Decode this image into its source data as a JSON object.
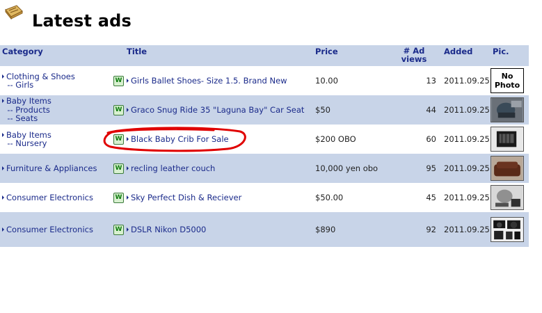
{
  "page": {
    "title": "Latest ads"
  },
  "colors": {
    "header_bg": "#c8d4e8",
    "link": "#1a2a8a",
    "annotation": "#e00000"
  },
  "table": {
    "headers": {
      "category": "Category",
      "title": "Title",
      "price": "Price",
      "views": "# Ad views",
      "added": "Added",
      "pic": "Pic."
    },
    "rows": [
      {
        "category": [
          "Clothing & Shoes",
          "-- Girls"
        ],
        "title": "Girls Ballet Shoes- Size 1.5. Brand New",
        "price": "10.00",
        "views": "13",
        "added": "2011.09.25",
        "pic": "No Photo"
      },
      {
        "category": [
          "Baby Items",
          "-- Products",
          "-- Seats"
        ],
        "title": "Graco Snug Ride 35 \"Laguna Bay\" Car Seat",
        "price": "$50",
        "views": "44",
        "added": "2011.09.25",
        "pic": "car-seat-photo"
      },
      {
        "category": [
          "Baby Items",
          "-- Nursery"
        ],
        "title": "Black Baby Crib For Sale",
        "price": "$200 OBO",
        "views": "60",
        "added": "2011.09.25",
        "pic": "crib-photo"
      },
      {
        "category": [
          "Furniture & Appliances"
        ],
        "title": "recling leather couch",
        "price": "10,000 yen obo",
        "views": "95",
        "added": "2011.09.25",
        "pic": "couch-photo"
      },
      {
        "category": [
          "Consumer Electronics"
        ],
        "title": "Sky Perfect Dish & Reciever",
        "price": "$50.00",
        "views": "45",
        "added": "2011.09.25",
        "pic": "dish-photo"
      },
      {
        "category": [
          "Consumer Electronics"
        ],
        "title": "DSLR Nikon D5000",
        "price": "$890",
        "views": "92",
        "added": "2011.09.25",
        "pic": "camera-photo"
      }
    ]
  },
  "icons": {
    "logo": "ad-board-icon",
    "title_badge": "w-badge-icon",
    "bullet": "triangle-bullet-icon"
  },
  "badge_letter": "W"
}
